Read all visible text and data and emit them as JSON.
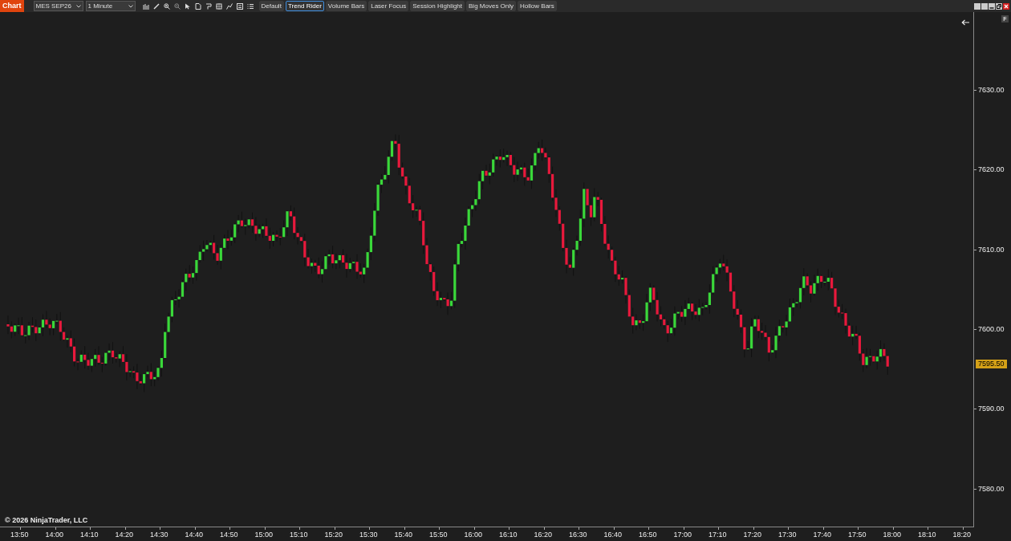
{
  "window": {
    "title": "Chart"
  },
  "toolbar": {
    "instrument": "MES SEP26",
    "interval": "1 Minute",
    "templates": [
      {
        "label": "Default",
        "selected": false
      },
      {
        "label": "Trend Rider",
        "selected": true
      },
      {
        "label": "Volume Bars",
        "selected": false
      },
      {
        "label": "Laser Focus",
        "selected": false
      },
      {
        "label": "Session Highlight",
        "selected": false
      },
      {
        "label": "Big Moves Only",
        "selected": false
      },
      {
        "label": "Hollow Bars",
        "selected": false
      }
    ]
  },
  "chart": {
    "panel_label": "F",
    "price_labels": [
      "7630.00",
      "7620.00",
      "7610.00",
      "7600.00",
      "7590.00",
      "7580.00"
    ],
    "current_price": "7595.50",
    "time_labels": [
      "13:50",
      "14:00",
      "14:10",
      "14:20",
      "14:30",
      "14:40",
      "14:50",
      "15:00",
      "15:10",
      "15:20",
      "15:30",
      "15:40",
      "15:50",
      "16:00",
      "16:10",
      "16:20",
      "16:30",
      "16:40",
      "16:50",
      "17:00",
      "17:10",
      "17:20",
      "17:30",
      "17:40",
      "17:50",
      "18:00",
      "18:10",
      "18:20"
    ],
    "copyright": "© 2026 NinjaTrader, LLC"
  }
}
